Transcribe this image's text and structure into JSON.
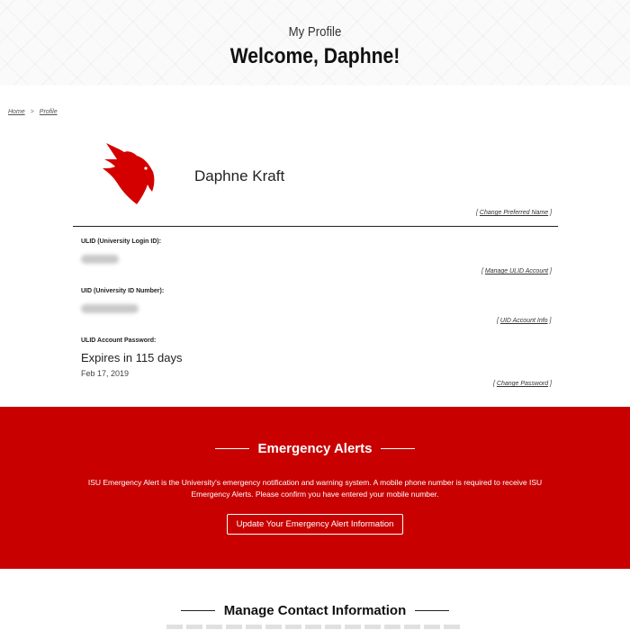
{
  "hero": {
    "subtitle": "My Profile",
    "title": "Welcome, Daphne!"
  },
  "breadcrumb": {
    "home": "Home",
    "separator": ">",
    "current": "Profile"
  },
  "profile": {
    "name": "Daphne Kraft",
    "change_preferred_name": "Change Preferred Name"
  },
  "fields": {
    "ulid_label": "ULID (University Login ID):",
    "manage_ulid": "Manage ULID Account",
    "uid_label": "UID (University ID Number):",
    "uid_info": "UID Account Info",
    "password_label": "ULID Account Password:",
    "expires": "Expires in 115 days",
    "expires_date": "Feb 17, 2019",
    "change_password": "Change Password"
  },
  "emergency": {
    "title": "Emergency Alerts",
    "text": "ISU Emergency Alert is the University's emergency notification and warning system. A mobile phone number is required to receive ISU Emergency Alerts. Please confirm you have entered your mobile number.",
    "button": "Update Your Emergency Alert Information",
    "background": "#c80000"
  },
  "contact": {
    "title": "Manage Contact Information"
  },
  "colors": {
    "brand_red": "#c80000"
  }
}
